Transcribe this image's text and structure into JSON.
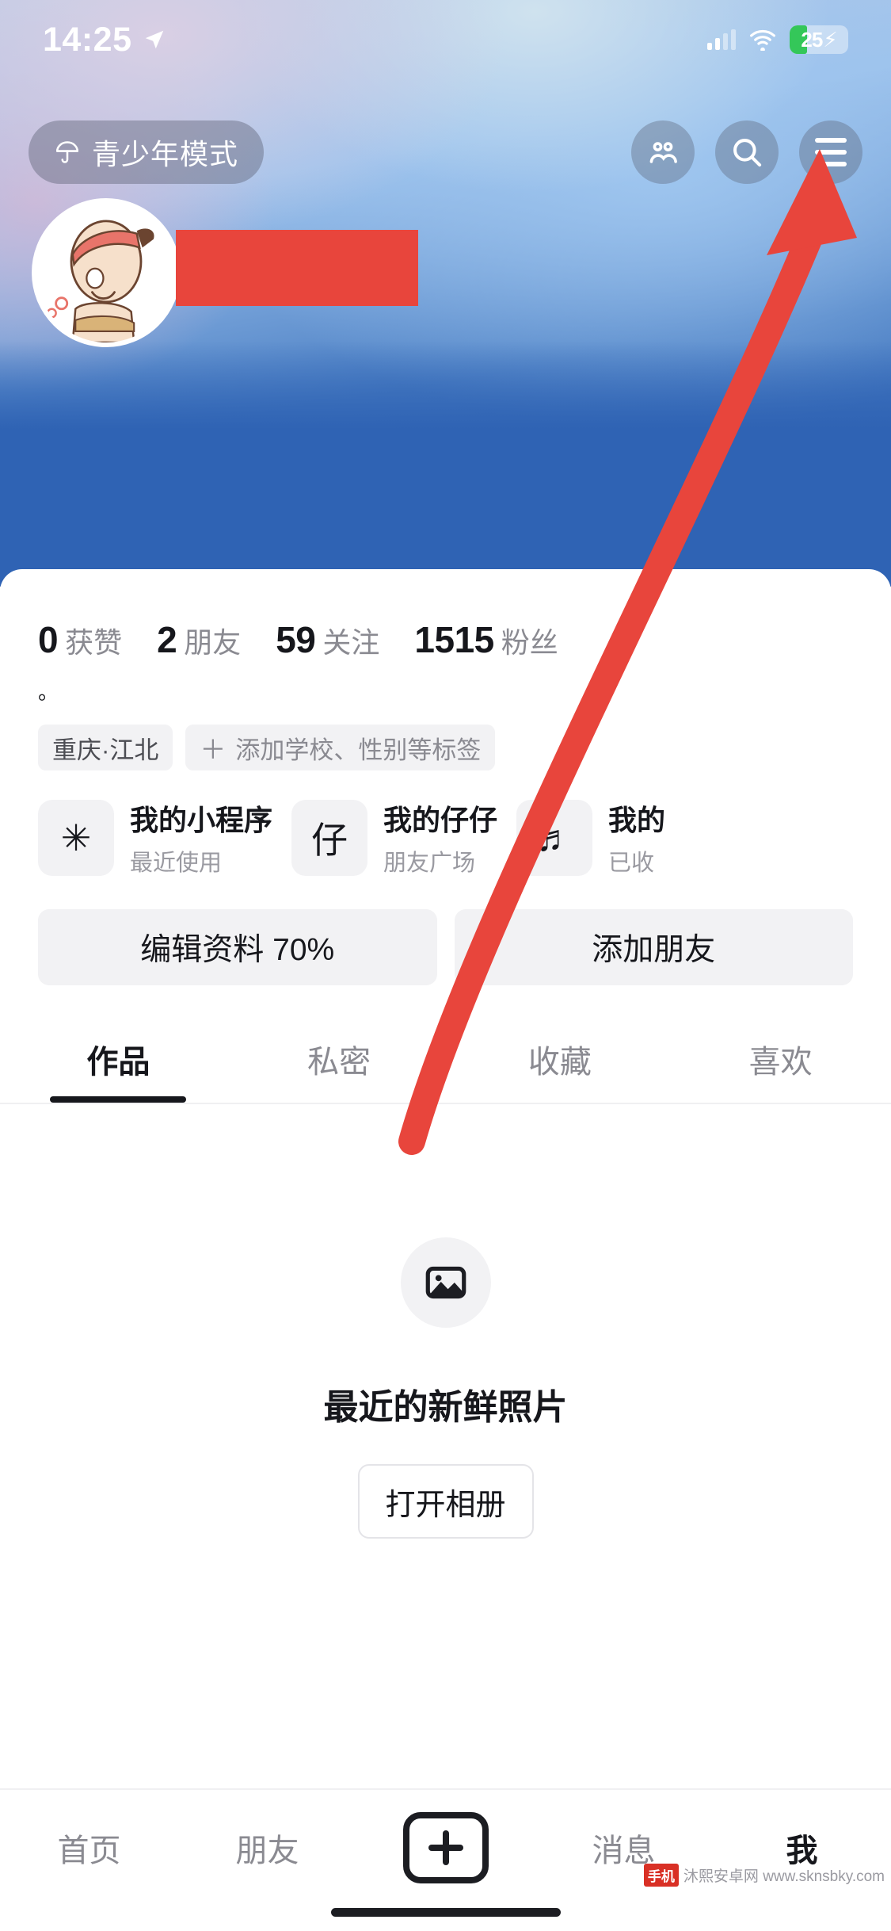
{
  "status_bar": {
    "time": "14:25",
    "location_icon": "location-arrow-icon",
    "signal_icon": "cellular-signal-icon",
    "wifi_icon": "wifi-icon",
    "battery_percent": "25",
    "battery_charging": "⚡"
  },
  "header": {
    "teen_mode_label": "青少年模式",
    "teen_mode_icon": "umbrella-icon",
    "friends_icon": "people-icon",
    "search_icon": "search-icon",
    "menu_icon": "hamburger-menu-icon"
  },
  "profile": {
    "avatar_alt": "avatar",
    "name_redacted": "",
    "bio": "。",
    "stats": [
      {
        "num": "0",
        "label": "获赞"
      },
      {
        "num": "2",
        "label": "朋友"
      },
      {
        "num": "59",
        "label": "关注"
      },
      {
        "num": "1515",
        "label": "粉丝"
      }
    ],
    "tags": [
      {
        "text": "重庆·江北",
        "has_plus": false
      },
      {
        "text": "添加学校、性别等标签",
        "has_plus": true
      }
    ]
  },
  "cards": [
    {
      "icon": "✳",
      "icon_name": "mini-program-icon",
      "title": "我的小程序",
      "subtitle": "最近使用"
    },
    {
      "icon": "仔",
      "icon_name": "zaizai-icon",
      "title": "我的仔仔",
      "subtitle": "朋友广场"
    },
    {
      "icon": "♬",
      "icon_name": "music-note-icon",
      "title": "我的",
      "subtitle": "已收"
    }
  ],
  "actions": [
    {
      "label": "编辑资料 70%"
    },
    {
      "label": "添加朋友"
    }
  ],
  "tabs": [
    {
      "label": "作品",
      "active": true
    },
    {
      "label": "私密",
      "active": false
    },
    {
      "label": "收藏",
      "active": false
    },
    {
      "label": "喜欢",
      "active": false
    }
  ],
  "empty_state": {
    "icon_name": "photo-placeholder-icon",
    "title": "最近的新鲜照片",
    "button_label": "打开相册"
  },
  "bottom_nav": {
    "items": [
      {
        "label": "首页",
        "active": false
      },
      {
        "label": "朋友",
        "active": false
      },
      {
        "label": "消息",
        "active": false
      },
      {
        "label": "我",
        "active": true
      }
    ],
    "create_icon": "plus-button-icon"
  },
  "annotation": {
    "arrow_color": "#e8453c",
    "points_to": "hamburger-menu-icon"
  },
  "watermark": {
    "badge": "手机",
    "text": "沐熙安卓网  www.sknsbky.com"
  },
  "colors": {
    "accent_red": "#e8453c",
    "cover_blue": "#2f63b4",
    "text_primary": "#16171c",
    "text_muted": "#8a8a91",
    "chip_bg": "#f2f2f4"
  }
}
